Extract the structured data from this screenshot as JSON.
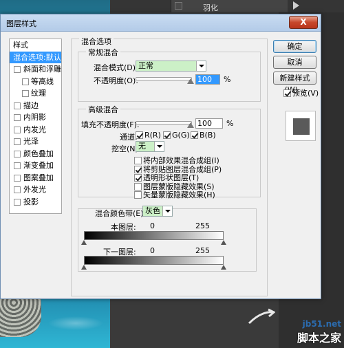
{
  "background": {
    "feather_label": "羽化"
  },
  "dialog": {
    "title": "图层样式",
    "close_label": "X"
  },
  "styles_list": {
    "header": "样式",
    "selected": "混合选项:默认",
    "items": [
      {
        "label": "斜面和浮雕",
        "indent": false,
        "checked": false
      },
      {
        "label": "等高线",
        "indent": true,
        "checked": false
      },
      {
        "label": "纹理",
        "indent": true,
        "checked": false
      },
      {
        "label": "描边",
        "indent": false,
        "checked": false
      },
      {
        "label": "内阴影",
        "indent": false,
        "checked": false
      },
      {
        "label": "内发光",
        "indent": false,
        "checked": false
      },
      {
        "label": "光泽",
        "indent": false,
        "checked": false
      },
      {
        "label": "颜色叠加",
        "indent": false,
        "checked": false
      },
      {
        "label": "渐变叠加",
        "indent": false,
        "checked": false
      },
      {
        "label": "图案叠加",
        "indent": false,
        "checked": false
      },
      {
        "label": "外发光",
        "indent": false,
        "checked": false
      },
      {
        "label": "投影",
        "indent": false,
        "checked": false
      }
    ]
  },
  "blending": {
    "section_title": "混合选项",
    "general": {
      "title": "常规混合",
      "mode_label": "混合模式(D):",
      "mode_value": "正常",
      "opacity_label": "不透明度(O):",
      "opacity_value": "100",
      "opacity_unit": "%"
    },
    "advanced": {
      "title": "高级混合",
      "fill_label": "填充不透明度(F):",
      "fill_value": "100",
      "fill_unit": "%",
      "channels_label": "通道:",
      "channels": [
        {
          "label": "R(R)",
          "checked": true
        },
        {
          "label": "G(G)",
          "checked": true
        },
        {
          "label": "B(B)",
          "checked": true
        }
      ],
      "knockout_label": "挖空(N):",
      "knockout_value": "无",
      "options": [
        {
          "label": "将内部效果混合成组(I)",
          "checked": false
        },
        {
          "label": "将剪贴图层混合成组(P)",
          "checked": true
        },
        {
          "label": "透明形状图层(T)",
          "checked": true
        },
        {
          "label": "图层蒙版隐藏效果(S)",
          "checked": false
        },
        {
          "label": "矢量蒙版隐藏效果(H)",
          "checked": false
        }
      ]
    },
    "blend_if": {
      "label": "混合颜色带(E):",
      "value": "灰色",
      "this_layer_label": "本图层:",
      "this_layer_min": "0",
      "this_layer_max": "255",
      "underlying_label": "下一图层:",
      "underlying_min": "0",
      "underlying_max": "255"
    }
  },
  "buttons": {
    "ok": "确定",
    "cancel": "取消",
    "new_style": "新建样式(W)...",
    "preview_label": "预览(V)",
    "preview_checked": true
  },
  "watermark": {
    "url": "jb51.net",
    "name": "脚本之家"
  },
  "colors": {
    "selection": "#3399ff",
    "select_bg": "#ccf0c7",
    "title_bar": "#c9dcf2",
    "close_button": "#c7472b"
  }
}
